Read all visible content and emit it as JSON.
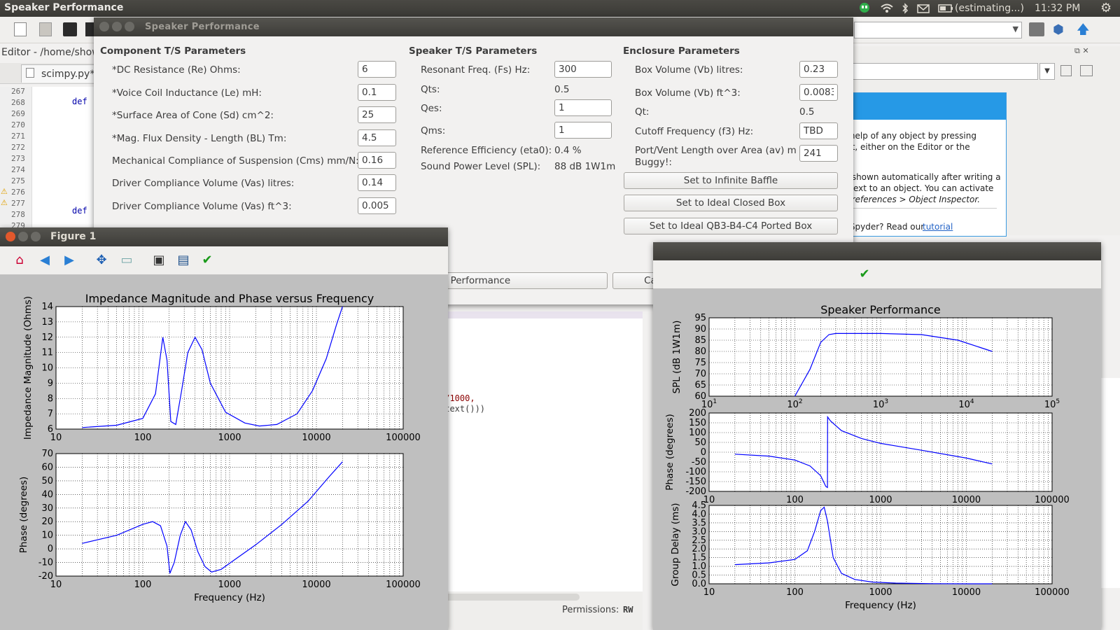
{
  "topbar": {
    "title": "Speaker Performance",
    "battery": "(estimating...)",
    "time": "11:32 PM"
  },
  "spyder": {
    "editor_label": "Editor - /home/show",
    "file_tab": "scimpy.py*",
    "line_numbers": [
      "267",
      "268",
      "269",
      "270",
      "271",
      "272",
      "273",
      "274",
      "275",
      "276",
      "277",
      "278",
      "279"
    ],
    "code_def": "def",
    "code_fragment_1": ")/1000,",
    "code_fragment_2": ".text()))",
    "help_text_1": "et help of any object by pressing",
    "help_text_2": "of it, either on the Editor or the",
    "help_text_3": "be shown automatically after writing a",
    "help_text_4": "is next to an object. You can activate",
    "help_text_5": "n Preferences > Object Inspector.",
    "help_text_6": "to Spyder? Read our",
    "help_link": "tutorial",
    "permissions_label": "Permissions:",
    "permissions_value": "RW",
    "right_chars": [
      "d",
      "'",
      "n"
    ]
  },
  "dialog": {
    "title": "Speaker Performance",
    "component": {
      "heading": "Component T/S Parameters",
      "rows": [
        {
          "label": "*DC Resistance (Re) Ohms:",
          "value": "6"
        },
        {
          "label": "*Voice Coil Inductance (Le) mH:",
          "value": "0.1"
        },
        {
          "label": "*Surface Area of Cone (Sd) cm^2:",
          "value": "25"
        },
        {
          "label": "*Mag. Flux Density - Length (BL) Tm:",
          "value": "4.5"
        },
        {
          "label": "Mechanical Compliance of Suspension (Cms) mm/N:",
          "value": "0.16"
        },
        {
          "label": "Driver Compliance Volume (Vas) litres:",
          "value": "0.14"
        },
        {
          "label": "Driver Compliance Volume (Vas) ft^3:",
          "value": "0.005"
        }
      ]
    },
    "speaker": {
      "heading": "Speaker T/S Parameters",
      "fs_label": "Resonant Freq. (Fs) Hz:",
      "fs_value": "300",
      "qts_label": "Qts:",
      "qts_value": "0.5",
      "qes_label": "Qes:",
      "qes_value": "1",
      "qms_label": "Qms:",
      "qms_value": "1",
      "eta_label": "Reference Efficiency (eta0):",
      "eta_value": "0.4 %",
      "spl_label": "Sound Power Level (SPL):",
      "spl_value": "88 dB 1W1m"
    },
    "enclosure": {
      "heading": "Enclosure Parameters",
      "vb_l_label": "Box Volume (Vb) litres:",
      "vb_l_value": "0.23",
      "vb_ft_label": "Box Volume (Vb) ft^3:",
      "vb_ft_value": "0.0083",
      "qt_label": "Qt:",
      "qt_value": "0.5",
      "f3_label": "Cutoff Frequency (f3) Hz:",
      "f3_value": "TBD",
      "port_label": "Port/Vent Length over Area (av) m",
      "port_label2": "Buggy!:",
      "port_value": "241",
      "btn_infinite": "Set to Infinite Baffle",
      "btn_closed": "Set to Ideal Closed Box",
      "btn_ported": "Set to Ideal QB3-B4-C4 Ported Box"
    },
    "btn_perf": "e Performance",
    "btn_sealed": "Calculate Sealed Box Performace"
  },
  "figure1": {
    "title": "Figure 1"
  },
  "colors": {
    "line": "#0000ff",
    "grid": "#000000"
  },
  "chart_data": [
    {
      "type": "line",
      "title": "Impedance Magnitude and Phase versus Frequency",
      "xscale": "log",
      "xlim": [
        10,
        100000
      ],
      "xticks": [
        "10",
        "100",
        "1000",
        "10000",
        "100000"
      ],
      "ylabel": "Impedance Magnitude (Ohms)",
      "ylim": [
        6,
        14
      ],
      "yticks": [
        "6",
        "7",
        "8",
        "9",
        "10",
        "11",
        "12",
        "13",
        "14"
      ],
      "x": [
        20,
        50,
        100,
        140,
        170,
        190,
        210,
        240,
        280,
        330,
        400,
        480,
        600,
        900,
        1500,
        2200,
        3500,
        6000,
        9000,
        13000,
        17000,
        20000
      ],
      "y": [
        6.1,
        6.25,
        6.7,
        8.3,
        12.0,
        10.5,
        6.5,
        6.3,
        8.5,
        11.0,
        12.0,
        11.2,
        9.0,
        7.1,
        6.4,
        6.2,
        6.3,
        7.0,
        8.5,
        10.6,
        12.8,
        14.0
      ]
    },
    {
      "type": "line",
      "xscale": "log",
      "xlim": [
        10,
        100000
      ],
      "xticks": [
        "10",
        "100",
        "1000",
        "10000",
        "100000"
      ],
      "xlabel": "Frequency (Hz)",
      "ylabel": "Phase (degrees)",
      "ylim": [
        -20,
        70
      ],
      "yticks": [
        "-20",
        "-10",
        "0",
        "10",
        "20",
        "30",
        "40",
        "50",
        "60",
        "70"
      ],
      "x": [
        20,
        50,
        100,
        130,
        160,
        190,
        205,
        230,
        270,
        310,
        360,
        430,
        520,
        620,
        800,
        1200,
        2000,
        4000,
        8000,
        14000,
        20000
      ],
      "y": [
        4,
        10,
        18,
        20,
        17,
        2,
        -18,
        -10,
        10,
        20,
        14,
        -2,
        -13,
        -17,
        -15,
        -7,
        3,
        18,
        35,
        53,
        64
      ]
    },
    {
      "type": "line",
      "title": "Speaker Performance",
      "xscale": "log",
      "xlim": [
        10,
        100000
      ],
      "xticks": [
        "10^1",
        "10^2",
        "10^3",
        "10^4",
        "10^5"
      ],
      "ylabel": "SPL (dB 1W1m)",
      "ylim": [
        60,
        95
      ],
      "yticks": [
        "60",
        "65",
        "70",
        "75",
        "80",
        "85",
        "90",
        "95"
      ],
      "x": [
        100,
        150,
        200,
        250,
        300,
        500,
        1000,
        3000,
        8000,
        20000
      ],
      "y": [
        60,
        72,
        84,
        87.5,
        88,
        88,
        88,
        87.5,
        85,
        80
      ]
    },
    {
      "type": "line",
      "xscale": "log",
      "xlim": [
        10,
        100000
      ],
      "xticks": [
        "10",
        "100",
        "1000",
        "10000",
        "100000"
      ],
      "ylabel": "Phase (degrees)",
      "ylim": [
        -200,
        200
      ],
      "yticks": [
        "-200",
        "-150",
        "-100",
        "-50",
        "0",
        "50",
        "100",
        "150",
        "200"
      ],
      "x": [
        20,
        50,
        100,
        150,
        200,
        230,
        240,
        241,
        260,
        350,
        600,
        1000,
        3000,
        10000,
        20000
      ],
      "y": [
        -10,
        -20,
        -40,
        -70,
        -120,
        -175,
        -180,
        180,
        160,
        110,
        70,
        45,
        10,
        -30,
        -60
      ]
    },
    {
      "type": "line",
      "xscale": "log",
      "xlim": [
        10,
        100000
      ],
      "xticks": [
        "10",
        "100",
        "1000",
        "10000",
        "100000"
      ],
      "xlabel": "Frequency (Hz)",
      "ylabel": "Group Delay (ms)",
      "ylim": [
        0,
        4.5
      ],
      "yticks": [
        "0.0",
        "0.5",
        "1.0",
        "1.5",
        "2.0",
        "2.5",
        "3.0",
        "3.5",
        "4.0",
        "4.5"
      ],
      "x": [
        20,
        50,
        100,
        140,
        170,
        200,
        220,
        240,
        280,
        350,
        500,
        800,
        1500,
        4000,
        10000,
        20000
      ],
      "y": [
        1.1,
        1.2,
        1.4,
        1.9,
        3.0,
        4.2,
        4.4,
        3.6,
        1.5,
        0.6,
        0.25,
        0.1,
        0.04,
        0.01,
        0.0,
        0.0
      ]
    }
  ]
}
